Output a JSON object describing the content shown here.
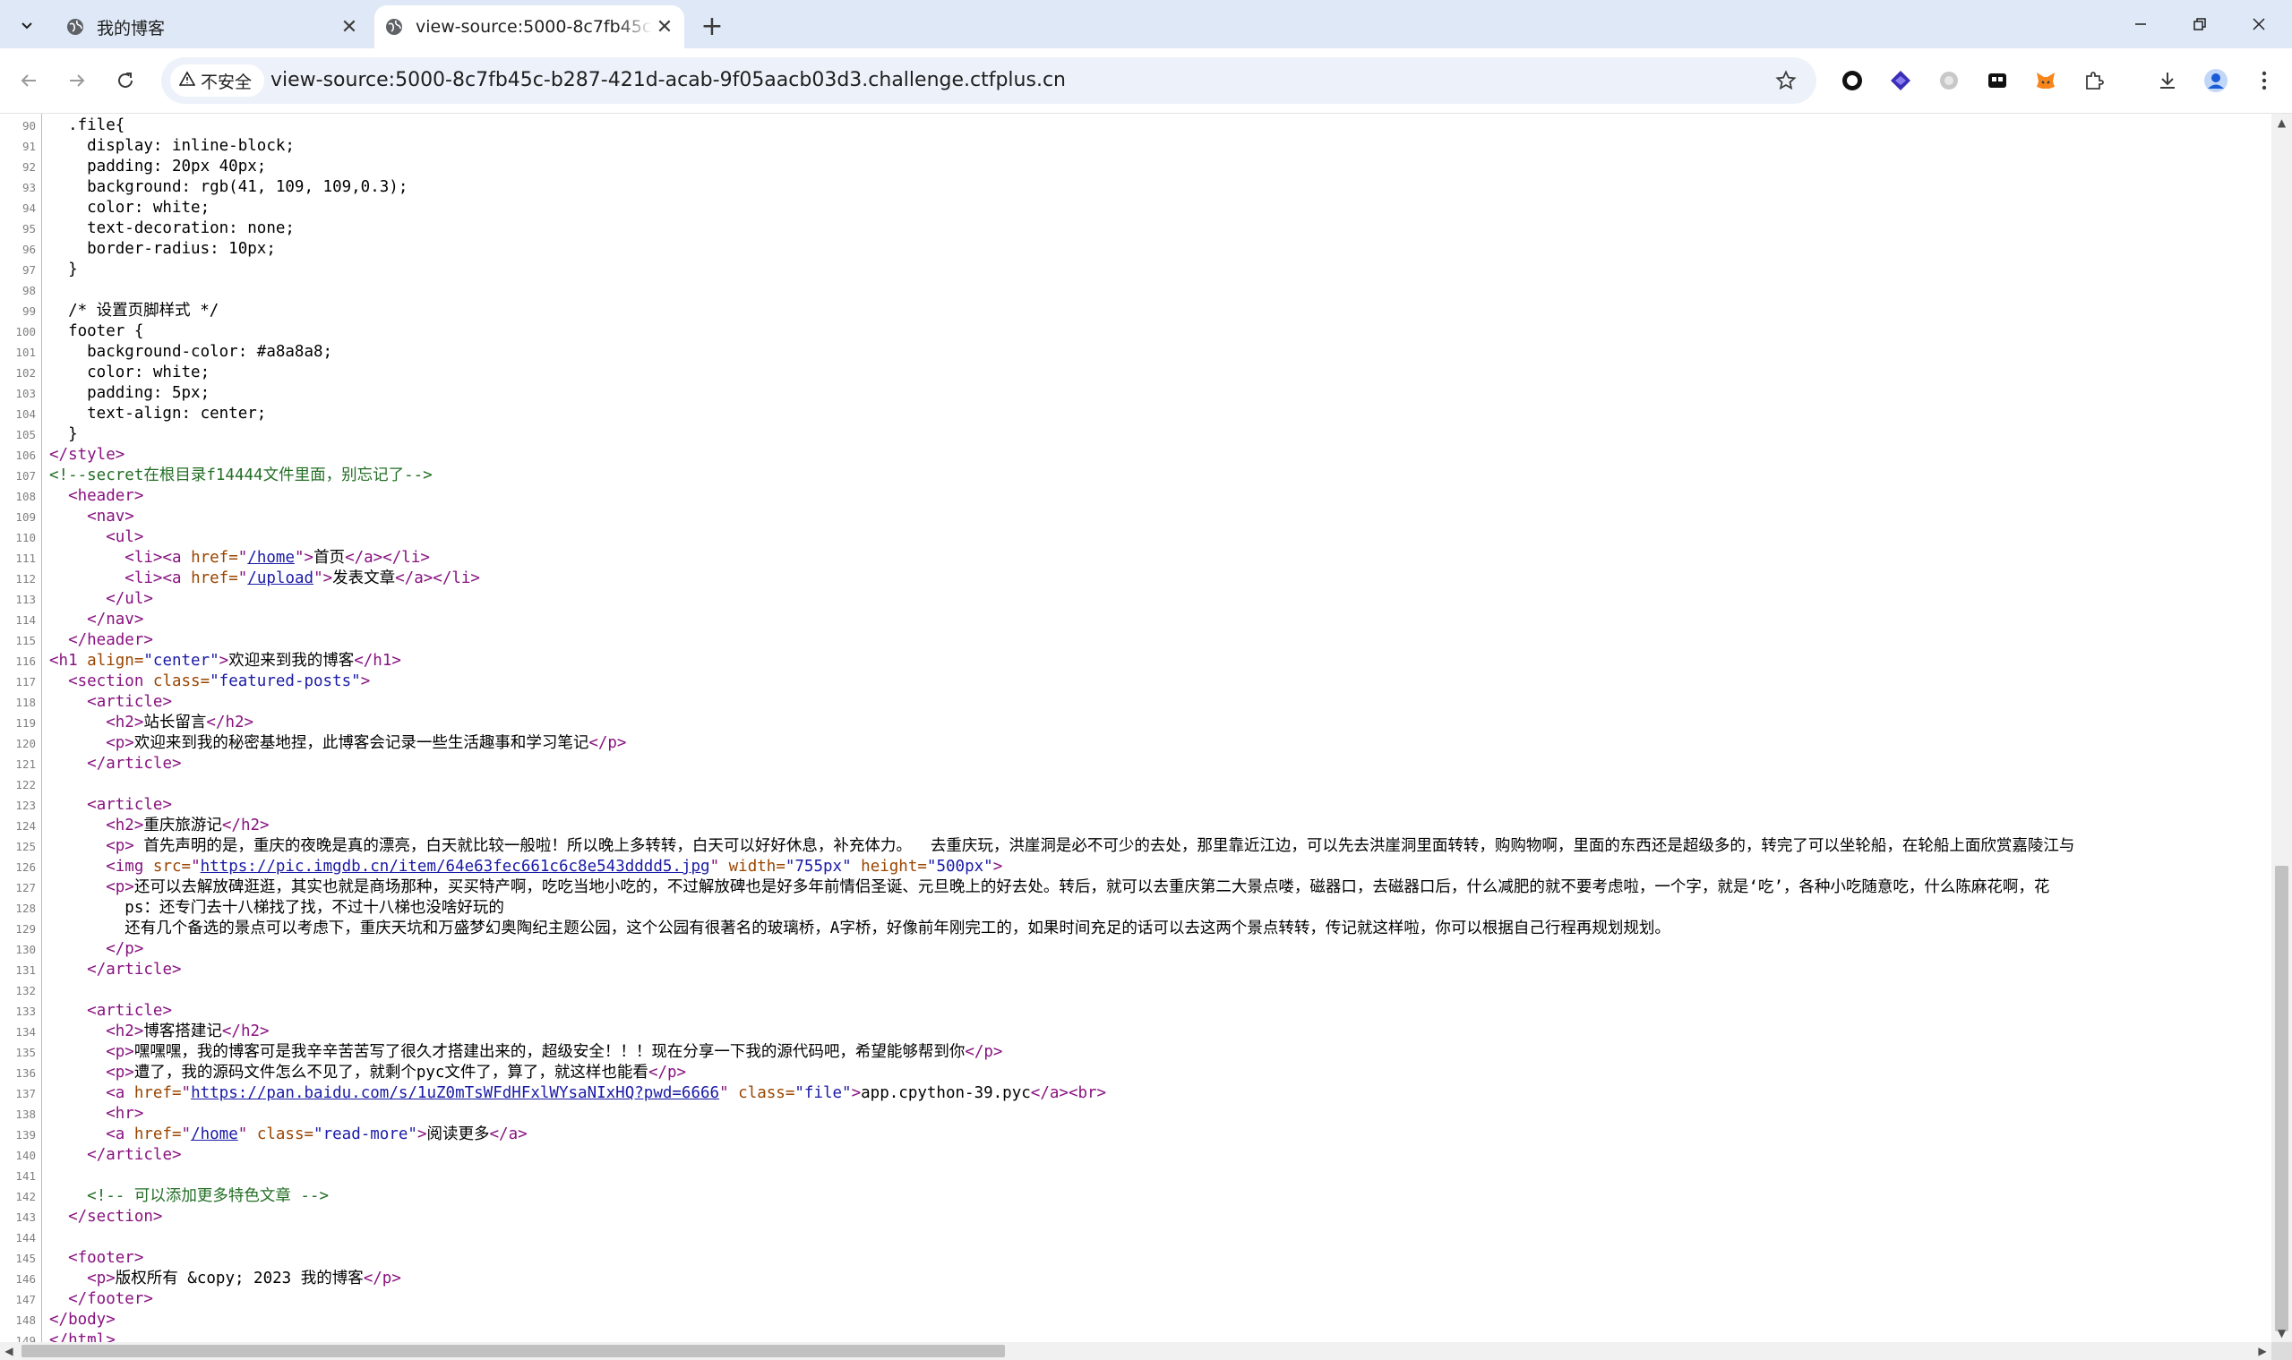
{
  "browser": {
    "tabs": [
      {
        "title": "我的博客",
        "active": false
      },
      {
        "title": "view-source:5000-8c7fb45c-b287-421d-acab-9f05aacb03d3.challenge.ctfplus.cn",
        "active": true
      }
    ],
    "new_tab": "+",
    "window_controls": {
      "minimize": "—",
      "maximize": "❐",
      "close": "✕"
    },
    "security_chip": "不安全",
    "url": "view-source:5000-8c7fb45c-b287-421d-acab-9f05aacb03d3.challenge.ctfplus.cn",
    "colors": {
      "tabstrip": "#dfe8f6",
      "omnibox": "#edf2fa",
      "tag": "#881280",
      "attr": "#994500",
      "value": "#1a1aa6",
      "comment": "#236e25"
    }
  },
  "source": {
    "lines": [
      {
        "n": "90",
        "segs": [
          {
            "t": "  .file{",
            "c": ""
          }
        ]
      },
      {
        "n": "91",
        "segs": [
          {
            "t": "    display: inline-block;",
            "c": ""
          }
        ]
      },
      {
        "n": "92",
        "segs": [
          {
            "t": "    padding: 20px 40px;",
            "c": ""
          }
        ]
      },
      {
        "n": "93",
        "segs": [
          {
            "t": "    background: rgb(41, 109, 109,0.3);",
            "c": ""
          }
        ]
      },
      {
        "n": "94",
        "segs": [
          {
            "t": "    color: white;",
            "c": ""
          }
        ]
      },
      {
        "n": "95",
        "segs": [
          {
            "t": "    text-decoration: none;",
            "c": ""
          }
        ]
      },
      {
        "n": "96",
        "segs": [
          {
            "t": "    border-radius: 10px;",
            "c": ""
          }
        ]
      },
      {
        "n": "97",
        "segs": [
          {
            "t": "  }",
            "c": ""
          }
        ]
      },
      {
        "n": "98",
        "segs": []
      },
      {
        "n": "99",
        "segs": [
          {
            "t": "  /* 设置页脚样式 */",
            "c": ""
          }
        ]
      },
      {
        "n": "100",
        "segs": [
          {
            "t": "  footer {",
            "c": ""
          }
        ]
      },
      {
        "n": "101",
        "segs": [
          {
            "t": "    background-color: #a8a8a8;",
            "c": ""
          }
        ]
      },
      {
        "n": "102",
        "segs": [
          {
            "t": "    color: white;",
            "c": ""
          }
        ]
      },
      {
        "n": "103",
        "segs": [
          {
            "t": "    padding: 5px;",
            "c": ""
          }
        ]
      },
      {
        "n": "104",
        "segs": [
          {
            "t": "    text-align: center;",
            "c": ""
          }
        ]
      },
      {
        "n": "105",
        "segs": [
          {
            "t": "  }",
            "c": ""
          }
        ]
      },
      {
        "n": "106",
        "segs": [
          {
            "t": "</style>",
            "c": "tag"
          }
        ]
      },
      {
        "n": "107",
        "segs": [
          {
            "t": "<!--secret在根目录f14444文件里面，别忘记了-->",
            "c": "cmt"
          }
        ]
      },
      {
        "n": "108",
        "segs": [
          {
            "t": "  ",
            "c": ""
          },
          {
            "t": "<header>",
            "c": "tag"
          }
        ]
      },
      {
        "n": "109",
        "segs": [
          {
            "t": "    ",
            "c": ""
          },
          {
            "t": "<nav>",
            "c": "tag"
          }
        ]
      },
      {
        "n": "110",
        "segs": [
          {
            "t": "      ",
            "c": ""
          },
          {
            "t": "<ul>",
            "c": "tag"
          }
        ]
      },
      {
        "n": "111",
        "segs": [
          {
            "t": "        ",
            "c": ""
          },
          {
            "t": "<li><a ",
            "c": "tag"
          },
          {
            "t": "href=",
            "c": "attr"
          },
          {
            "t": "\"",
            "c": "tag"
          },
          {
            "t": "/home",
            "c": "link"
          },
          {
            "t": "\">",
            "c": "tag"
          },
          {
            "t": "首页",
            "c": ""
          },
          {
            "t": "</a></li>",
            "c": "tag"
          }
        ]
      },
      {
        "n": "112",
        "segs": [
          {
            "t": "        ",
            "c": ""
          },
          {
            "t": "<li><a ",
            "c": "tag"
          },
          {
            "t": "href=",
            "c": "attr"
          },
          {
            "t": "\"",
            "c": "tag"
          },
          {
            "t": "/upload",
            "c": "link"
          },
          {
            "t": "\">",
            "c": "tag"
          },
          {
            "t": "发表文章",
            "c": ""
          },
          {
            "t": "</a></li>",
            "c": "tag"
          }
        ]
      },
      {
        "n": "113",
        "segs": [
          {
            "t": "      ",
            "c": ""
          },
          {
            "t": "</ul>",
            "c": "tag"
          }
        ]
      },
      {
        "n": "114",
        "segs": [
          {
            "t": "    ",
            "c": ""
          },
          {
            "t": "</nav>",
            "c": "tag"
          }
        ]
      },
      {
        "n": "115",
        "segs": [
          {
            "t": "  ",
            "c": ""
          },
          {
            "t": "</header>",
            "c": "tag"
          }
        ]
      },
      {
        "n": "116",
        "segs": [
          {
            "t": "<h1 ",
            "c": "tag"
          },
          {
            "t": "align=",
            "c": "attr"
          },
          {
            "t": "\"center\"",
            "c": "val"
          },
          {
            "t": ">",
            "c": "tag"
          },
          {
            "t": "欢迎来到我的博客",
            "c": ""
          },
          {
            "t": "</h1>",
            "c": "tag"
          }
        ]
      },
      {
        "n": "117",
        "segs": [
          {
            "t": "  ",
            "c": ""
          },
          {
            "t": "<section ",
            "c": "tag"
          },
          {
            "t": "class=",
            "c": "attr"
          },
          {
            "t": "\"featured-posts\"",
            "c": "val"
          },
          {
            "t": ">",
            "c": "tag"
          }
        ]
      },
      {
        "n": "118",
        "segs": [
          {
            "t": "    ",
            "c": ""
          },
          {
            "t": "<article>",
            "c": "tag"
          }
        ]
      },
      {
        "n": "119",
        "segs": [
          {
            "t": "      ",
            "c": ""
          },
          {
            "t": "<h2>",
            "c": "tag"
          },
          {
            "t": "站长留言",
            "c": ""
          },
          {
            "t": "</h2>",
            "c": "tag"
          }
        ]
      },
      {
        "n": "120",
        "segs": [
          {
            "t": "      ",
            "c": ""
          },
          {
            "t": "<p>",
            "c": "tag"
          },
          {
            "t": "欢迎来到我的秘密基地捏，此博客会记录一些生活趣事和学习笔记",
            "c": ""
          },
          {
            "t": "</p>",
            "c": "tag"
          }
        ]
      },
      {
        "n": "121",
        "segs": [
          {
            "t": "    ",
            "c": ""
          },
          {
            "t": "</article>",
            "c": "tag"
          }
        ]
      },
      {
        "n": "122",
        "segs": []
      },
      {
        "n": "123",
        "segs": [
          {
            "t": "    ",
            "c": ""
          },
          {
            "t": "<article>",
            "c": "tag"
          }
        ]
      },
      {
        "n": "124",
        "segs": [
          {
            "t": "      ",
            "c": ""
          },
          {
            "t": "<h2>",
            "c": "tag"
          },
          {
            "t": "重庆旅游记",
            "c": ""
          },
          {
            "t": "</h2>",
            "c": "tag"
          }
        ]
      },
      {
        "n": "125",
        "segs": [
          {
            "t": "      ",
            "c": ""
          },
          {
            "t": "<p>",
            "c": "tag"
          },
          {
            "t": " 首先声明的是，重庆的夜晚是真的漂亮，白天就比较一般啦！所以晚上多转转，白天可以好好休息，补充体力。  去重庆玩，洪崖洞是必不可少的去处，那里靠近江边，可以先去洪崖洞里面转转，购购物啊，里面的东西还是超级多的，转完了可以坐轮船，在轮船上面欣赏嘉陵江与",
            "c": ""
          }
        ]
      },
      {
        "n": "126",
        "segs": [
          {
            "t": "      ",
            "c": ""
          },
          {
            "t": "<img ",
            "c": "tag"
          },
          {
            "t": "src=",
            "c": "attr"
          },
          {
            "t": "\"",
            "c": "tag"
          },
          {
            "t": "https://pic.imgdb.cn/item/64e63fec661c6c8e543dddd5.jpg",
            "c": "link"
          },
          {
            "t": "\" ",
            "c": "tag"
          },
          {
            "t": "width=",
            "c": "attr"
          },
          {
            "t": "\"755px\" ",
            "c": "val"
          },
          {
            "t": "height=",
            "c": "attr"
          },
          {
            "t": "\"500px\"",
            "c": "val"
          },
          {
            "t": ">",
            "c": "tag"
          }
        ]
      },
      {
        "n": "127",
        "segs": [
          {
            "t": "      ",
            "c": ""
          },
          {
            "t": "<p>",
            "c": "tag"
          },
          {
            "t": "还可以去解放碑逛逛，其实也就是商场那种，买买特产啊，吃吃当地小吃的，不过解放碑也是好多年前情侣圣诞、元旦晚上的好去处。转后，就可以去重庆第二大景点喽，磁器口，去磁器口后，什么减肥的就不要考虑啦，一个字，就是‘吃’，各种小吃随意吃，什么陈麻花啊，花",
            "c": ""
          }
        ]
      },
      {
        "n": "128",
        "segs": [
          {
            "t": "        ps：还专门去十八梯找了找，不过十八梯也没啥好玩的",
            "c": ""
          }
        ]
      },
      {
        "n": "129",
        "segs": [
          {
            "t": "        还有几个备选的景点可以考虑下，重庆天坑和万盛梦幻奥陶纪主题公园，这个公园有很著名的玻璃桥，A字桥，好像前年刚完工的，如果时间充足的话可以去这两个景点转转，传记就这样啦，你可以根据自己行程再规划规划。",
            "c": ""
          }
        ]
      },
      {
        "n": "130",
        "segs": [
          {
            "t": "      ",
            "c": ""
          },
          {
            "t": "</p>",
            "c": "tag"
          }
        ]
      },
      {
        "n": "131",
        "segs": [
          {
            "t": "    ",
            "c": ""
          },
          {
            "t": "</article>",
            "c": "tag"
          }
        ]
      },
      {
        "n": "132",
        "segs": []
      },
      {
        "n": "133",
        "segs": [
          {
            "t": "    ",
            "c": ""
          },
          {
            "t": "<article>",
            "c": "tag"
          }
        ]
      },
      {
        "n": "134",
        "segs": [
          {
            "t": "      ",
            "c": ""
          },
          {
            "t": "<h2>",
            "c": "tag"
          },
          {
            "t": "博客搭建记",
            "c": ""
          },
          {
            "t": "</h2>",
            "c": "tag"
          }
        ]
      },
      {
        "n": "135",
        "segs": [
          {
            "t": "      ",
            "c": ""
          },
          {
            "t": "<p>",
            "c": "tag"
          },
          {
            "t": "嘿嘿嘿，我的博客可是我辛辛苦苦写了很久才搭建出来的，超级安全！！！现在分享一下我的源代码吧，希望能够帮到你",
            "c": ""
          },
          {
            "t": "</p>",
            "c": "tag"
          }
        ]
      },
      {
        "n": "136",
        "segs": [
          {
            "t": "      ",
            "c": ""
          },
          {
            "t": "<p>",
            "c": "tag"
          },
          {
            "t": "遭了，我的源码文件怎么不见了，就剩个pyc文件了，算了，就这样也能看",
            "c": ""
          },
          {
            "t": "</p>",
            "c": "tag"
          }
        ]
      },
      {
        "n": "137",
        "segs": [
          {
            "t": "      ",
            "c": ""
          },
          {
            "t": "<a ",
            "c": "tag"
          },
          {
            "t": "href=",
            "c": "attr"
          },
          {
            "t": "\"",
            "c": "tag"
          },
          {
            "t": "https://pan.baidu.com/s/1uZ0mTsWFdHFxlWYsaNIxHQ?pwd=6666",
            "c": "link"
          },
          {
            "t": "\" ",
            "c": "tag"
          },
          {
            "t": "class=",
            "c": "attr"
          },
          {
            "t": "\"file\"",
            "c": "val"
          },
          {
            "t": ">",
            "c": "tag"
          },
          {
            "t": "app.cpython-39.pyc",
            "c": ""
          },
          {
            "t": "</a><br>",
            "c": "tag"
          }
        ]
      },
      {
        "n": "138",
        "segs": [
          {
            "t": "      ",
            "c": ""
          },
          {
            "t": "<hr>",
            "c": "tag"
          }
        ]
      },
      {
        "n": "139",
        "segs": [
          {
            "t": "      ",
            "c": ""
          },
          {
            "t": "<a ",
            "c": "tag"
          },
          {
            "t": "href=",
            "c": "attr"
          },
          {
            "t": "\"",
            "c": "tag"
          },
          {
            "t": "/home",
            "c": "link"
          },
          {
            "t": "\" ",
            "c": "tag"
          },
          {
            "t": "class=",
            "c": "attr"
          },
          {
            "t": "\"read-more\"",
            "c": "val"
          },
          {
            "t": ">",
            "c": "tag"
          },
          {
            "t": "阅读更多",
            "c": ""
          },
          {
            "t": "</a>",
            "c": "tag"
          }
        ]
      },
      {
        "n": "140",
        "segs": [
          {
            "t": "    ",
            "c": ""
          },
          {
            "t": "</article>",
            "c": "tag"
          }
        ]
      },
      {
        "n": "141",
        "segs": []
      },
      {
        "n": "142",
        "segs": [
          {
            "t": "    ",
            "c": ""
          },
          {
            "t": "<!-- 可以添加更多特色文章 -->",
            "c": "cmt"
          }
        ]
      },
      {
        "n": "143",
        "segs": [
          {
            "t": "  ",
            "c": ""
          },
          {
            "t": "</section>",
            "c": "tag"
          }
        ]
      },
      {
        "n": "144",
        "segs": []
      },
      {
        "n": "145",
        "segs": [
          {
            "t": "  ",
            "c": ""
          },
          {
            "t": "<footer>",
            "c": "tag"
          }
        ]
      },
      {
        "n": "146",
        "segs": [
          {
            "t": "    ",
            "c": ""
          },
          {
            "t": "<p>",
            "c": "tag"
          },
          {
            "t": "版权所有 &copy; 2023 我的博客",
            "c": ""
          },
          {
            "t": "</p>",
            "c": "tag"
          }
        ]
      },
      {
        "n": "147",
        "segs": [
          {
            "t": "  ",
            "c": ""
          },
          {
            "t": "</footer>",
            "c": "tag"
          }
        ]
      },
      {
        "n": "148",
        "segs": [
          {
            "t": "</body>",
            "c": "tag"
          }
        ]
      },
      {
        "n": "149",
        "segs": [
          {
            "t": "</html>",
            "c": "tag"
          }
        ]
      }
    ]
  }
}
